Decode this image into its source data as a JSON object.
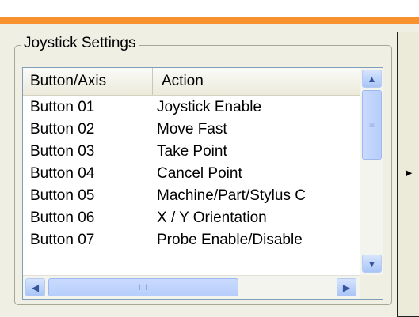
{
  "panel": {
    "group_title": "Joystick Settings",
    "accent_color": "#f7922f"
  },
  "table": {
    "columns": [
      "Button/Axis",
      "Action"
    ],
    "rows": [
      {
        "button": "Button 01",
        "action": "Joystick Enable"
      },
      {
        "button": "Button 02",
        "action": "Move Fast"
      },
      {
        "button": "Button 03",
        "action": "Take Point"
      },
      {
        "button": "Button 04",
        "action": "Cancel Point"
      },
      {
        "button": "Button 05",
        "action": "Machine/Part/Stylus C"
      },
      {
        "button": "Button 06",
        "action": "X / Y Orientation"
      },
      {
        "button": "Button 07",
        "action": "Probe Enable/Disable"
      }
    ]
  },
  "icons": {
    "scroll_up": "▲",
    "scroll_down": "▼",
    "scroll_left": "◀",
    "scroll_right": "▶",
    "grip_vertical": "≡",
    "grip_horizontal": "III",
    "expand_arrow": "►"
  }
}
